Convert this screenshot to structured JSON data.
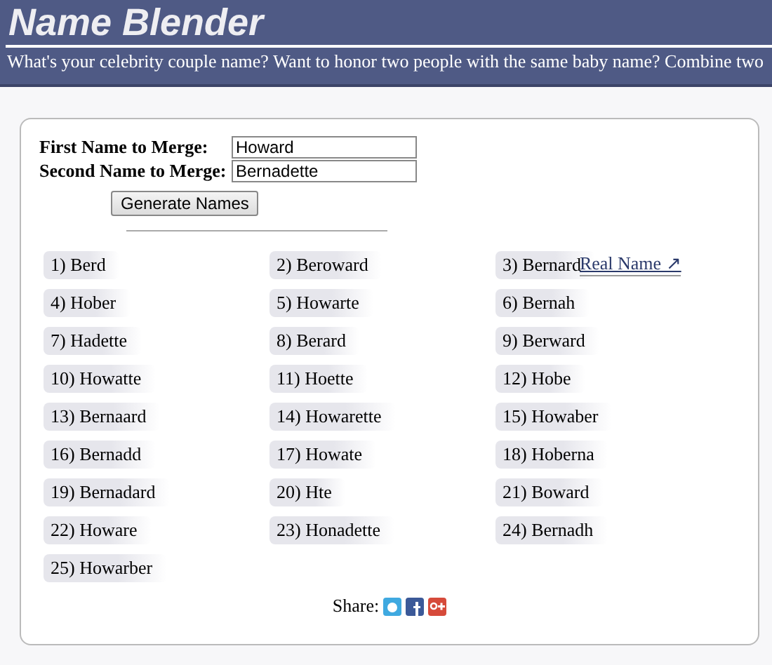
{
  "header": {
    "title": "Name Blender",
    "subtitle": "What's your celebrity couple name? Want to honor two people with the same baby name? Combine two"
  },
  "form": {
    "fields": [
      {
        "label": "First Name to Merge:",
        "value": "Howard"
      },
      {
        "label": "Second Name to Merge:",
        "value": "Bernadette"
      }
    ],
    "button": "Generate Names"
  },
  "results": [
    {
      "text": "1) Berd"
    },
    {
      "text": "2) Beroward"
    },
    {
      "text": "3) Bernard",
      "link": "Real Name ↗"
    },
    {
      "text": "4) Hober"
    },
    {
      "text": "5) Howarte"
    },
    {
      "text": "6) Bernah"
    },
    {
      "text": "7) Hadette"
    },
    {
      "text": "8) Berard"
    },
    {
      "text": "9) Berward"
    },
    {
      "text": "10) Howatte"
    },
    {
      "text": "11) Hoette"
    },
    {
      "text": "12) Hobe"
    },
    {
      "text": "13) Bernaard"
    },
    {
      "text": "14) Howarette"
    },
    {
      "text": "15) Howaber"
    },
    {
      "text": "16) Bernadd"
    },
    {
      "text": "17) Howate"
    },
    {
      "text": "18) Hoberna"
    },
    {
      "text": "19) Bernadard"
    },
    {
      "text": "20) Hte"
    },
    {
      "text": "21) Boward"
    },
    {
      "text": "22) Howare"
    },
    {
      "text": "23) Honadette"
    },
    {
      "text": "24) Bernadh"
    },
    {
      "text": "25) Howarber"
    }
  ],
  "share": {
    "label": "Share:"
  }
}
